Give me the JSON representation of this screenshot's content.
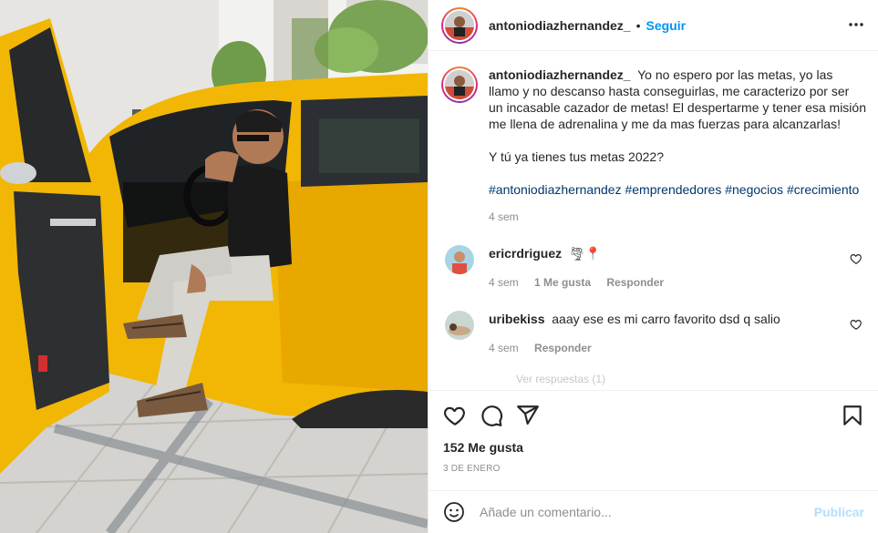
{
  "post": {
    "author": "antoniodiazhernandez_",
    "follow_label": "Seguir",
    "separator": "•"
  },
  "caption": {
    "username": "antoniodiazhernandez_",
    "paragraph1": "Yo no espero por las metas, yo las llamo y no descanso hasta conseguirlas, me caracterizo por ser un incasable cazador de metas! El despertarme y tener esa misión me llena de adrenalina y me da mas fuerzas para alcanzarlas!",
    "paragraph2": "Y tú ya tienes tus metas 2022?",
    "hashtags": [
      "#antoniodiazhernandez",
      "#emprendedores",
      "#negocios",
      "#crecimiento"
    ],
    "time": "4 sem"
  },
  "comments": [
    {
      "username": "ericrdriguez",
      "text": "🌪📍",
      "time": "4 sem",
      "likes": "1 Me gusta",
      "reply": "Responder"
    },
    {
      "username": "uribekiss",
      "text": "aaay ese es mi carro favorito dsd q salio",
      "time": "4 sem",
      "reply": "Responder"
    }
  ],
  "more_replies": "Ver respuestas (1)",
  "stats": {
    "likes": "152 Me gusta",
    "date": "3 DE ENERO"
  },
  "add_comment": {
    "placeholder": "Añade un comentario...",
    "publish_label": "Publicar"
  },
  "colors": {
    "accent_blue": "#0095f6",
    "hashtag_blue": "#00376b",
    "car_yellow": "#f2b705",
    "muted_text": "#8e8e8e"
  },
  "icons": [
    "more-options-icon",
    "heart-icon",
    "comment-icon",
    "share-icon",
    "bookmark-icon",
    "emoji-icon",
    "comment-heart-icon"
  ]
}
